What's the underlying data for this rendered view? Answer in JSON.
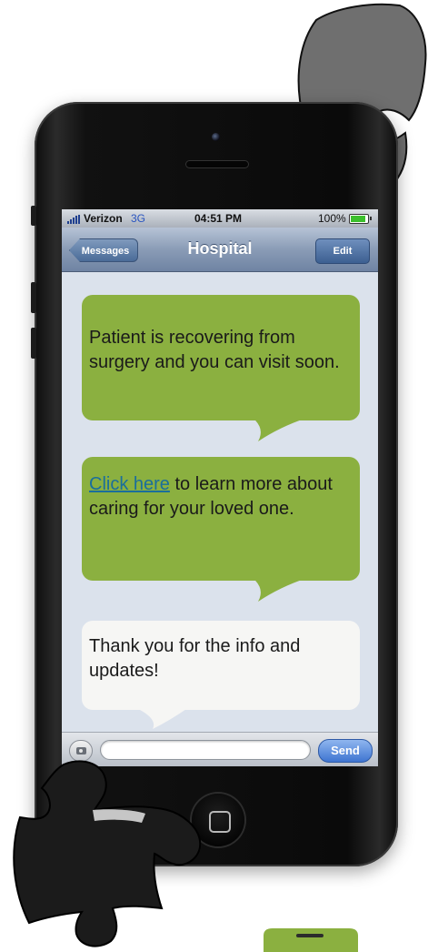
{
  "status_bar": {
    "carrier": "Verizon",
    "network": "3G",
    "time": "04:51 PM",
    "battery_percent_text": "100%",
    "battery_level": 1.0
  },
  "nav_bar": {
    "back_label": "Messages",
    "title": "Hospital",
    "edit_label": "Edit"
  },
  "messages": [
    {
      "direction": "incoming",
      "color": "#8bb040",
      "text": "Patient is recovering from surgery and you can visit soon."
    },
    {
      "direction": "incoming",
      "color": "#8bb040",
      "link_text": "Click here",
      "text_after_link": " to learn more about caring for your loved one."
    },
    {
      "direction": "outgoing",
      "color": "#f6f6f4",
      "text": "Thank you for the info and updates!"
    }
  ],
  "input_bar": {
    "field_value": "",
    "send_label": "Send"
  },
  "colors": {
    "accent_green": "#8bb040",
    "puzzle_dark": "#1b1b1b",
    "puzzle_grey": "#6f6f6f"
  }
}
